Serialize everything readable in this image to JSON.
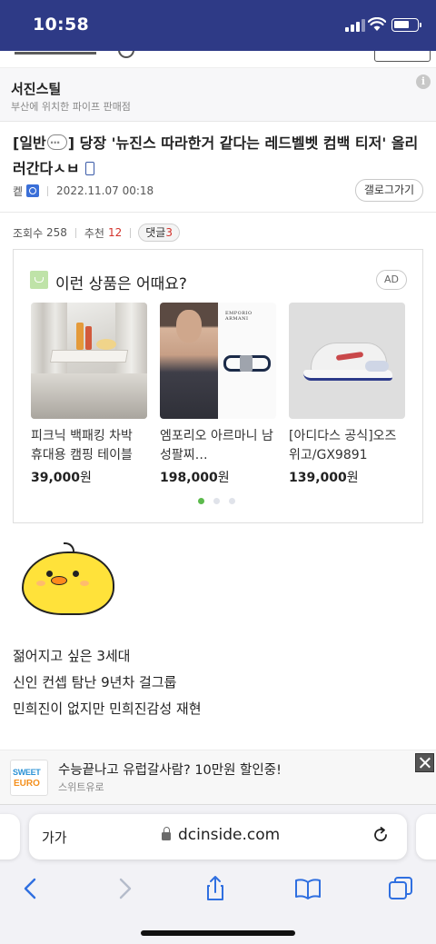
{
  "status_bar": {
    "time": "10:58",
    "battery_level": 0.7
  },
  "shop_banner": {
    "name": "서진스틸",
    "description": "부산에 위치한 파이프 판매점",
    "info_icon": "i"
  },
  "post": {
    "title_prefix": "[일반",
    "title_suffix": "] 당장 '뉴진스 따라한거 같다는 레드벨벳 컴백 티저' 올리러간다ㅅㅂ",
    "author": "켙",
    "date": "2022.11.07 00:18",
    "gallery_button": "갤로그가기",
    "views_label": "조회수",
    "views": "258",
    "recommend_label": "추천",
    "recommend": "12",
    "comments_label": "댓글",
    "comments": "3"
  },
  "ad_box": {
    "heading": "이런 상품은 어때요?",
    "ad_label": "AD",
    "products": [
      {
        "name": "피크닉 백패킹 차박 휴대용 캠핑 테이블",
        "price": "39,000",
        "currency": "원"
      },
      {
        "name": "엠포리오 아르마니 남성팔찌…",
        "price": "198,000",
        "currency": "원",
        "brand_text": "EMPORIO ARMANI"
      },
      {
        "name": "[아디다스 공식]오즈위고/GX9891",
        "price": "139,000",
        "currency": "원"
      }
    ],
    "page_dots": 3,
    "active_dot": 0
  },
  "body_lines": [
    "젊어지고 싶은 3세대",
    "신인 컨셉 탐난 9년차 걸그룹",
    "민희진이 없지만 민희진감성 재현"
  ],
  "bottom_ad": {
    "logo_line1": "SWEET",
    "logo_line2": "EURO",
    "title": "수능끝나고 유럽갈사람? 10만원 할인중!",
    "subtitle": "스위트유로"
  },
  "browser": {
    "aa_label": "가가",
    "url": "dcinside.com"
  },
  "colors": {
    "status_bar_bg": "#2e3a86",
    "accent_red": "#d3322b",
    "dot_active": "#5cba4c"
  },
  "icons": [
    "signal-icon",
    "wifi-icon",
    "battery-icon",
    "info-icon",
    "speech-bubble-icon",
    "phone-icon",
    "author-badge-icon",
    "shopping-bag-icon",
    "close-icon",
    "lock-icon",
    "reload-icon",
    "back-icon",
    "forward-icon",
    "share-icon",
    "bookmarks-icon",
    "tabs-icon"
  ]
}
